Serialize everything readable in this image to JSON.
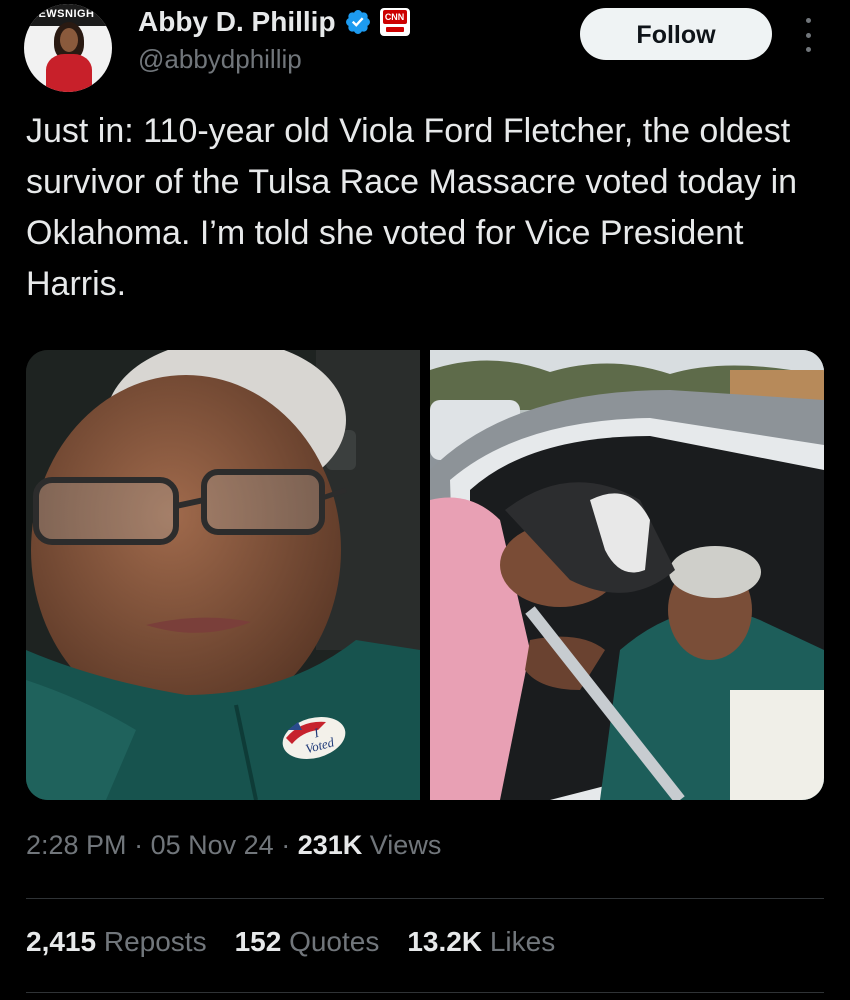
{
  "author": {
    "display_name": "Abby D. Phillip",
    "handle": "@abbydphillip",
    "avatar_banner_text": "NEWSNIGH",
    "affiliate_badge_text": "CNN",
    "avatar": "profile-photo",
    "verified_icon": "verified-badge-icon",
    "affiliate_icon": "cnn-logo-icon"
  },
  "actions": {
    "follow_label": "Follow",
    "more_icon": "more-options-icon"
  },
  "tweet": {
    "text": "Just in: 110-year old Viola Ford Fletcher, the oldest survivor of the Tulsa Race Massacre voted today in Oklahoma. I’m told she voted for Vice President Harris.",
    "photo_1": {
      "sticker_line1": "I",
      "sticker_line2": "Voted"
    },
    "photo_2": {},
    "time": "2:28 PM",
    "date": "05 Nov 24",
    "views_count": "231K",
    "views_label": "Views",
    "separator": "·"
  },
  "stats": {
    "reposts_count": "2,415",
    "reposts_label": "Reposts",
    "quotes_count": "152",
    "quotes_label": "Quotes",
    "likes_count": "13.2K",
    "likes_label": "Likes"
  },
  "colors": {
    "background": "#000000",
    "text_primary": "#e7e9ea",
    "text_secondary": "#71767b",
    "verified_blue": "#1d9bf0",
    "follow_button_bg": "#eff3f4",
    "divider": "#2f3336"
  }
}
